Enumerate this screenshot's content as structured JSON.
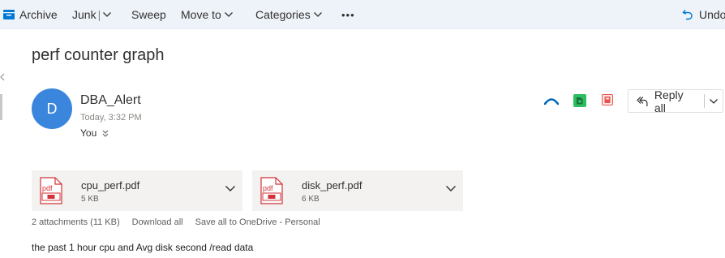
{
  "toolbar": {
    "archive_label": "Archive",
    "junk_label": "Junk",
    "junk_separator": "|",
    "sweep_label": "Sweep",
    "move_to_label": "Move to",
    "categories_label": "Categories",
    "more_label": "•••",
    "undo_label": "Undo"
  },
  "message": {
    "subject": "perf counter graph",
    "sender_initial": "D",
    "sender_name": "DBA_Alert",
    "sent_time": "Today, 3:32 PM",
    "recipients": "You"
  },
  "actions": {
    "reply_all_label": "Reply all"
  },
  "attachments": [
    {
      "name": "cpu_perf.pdf",
      "size": "5 KB",
      "icon": "pdf-icon",
      "icon_text": "pdf"
    },
    {
      "name": "disk_perf.pdf",
      "size": "6 KB",
      "icon": "pdf-icon",
      "icon_text": "pdf"
    }
  ],
  "attachment_meta": {
    "count_label": "2 attachments (11 KB)",
    "download_all": "Download all",
    "save_all": "Save all to OneDrive - Personal"
  },
  "body_text": "the past 1 hour cpu and Avg disk second /read data",
  "colors": {
    "accent": "#0078d4",
    "avatar": "#3a86dd",
    "toolbar_bg": "#eef3f9",
    "pdf_red": "#d13438",
    "evernote_green": "#2dbe60",
    "onenote_red": "#e8524e"
  }
}
